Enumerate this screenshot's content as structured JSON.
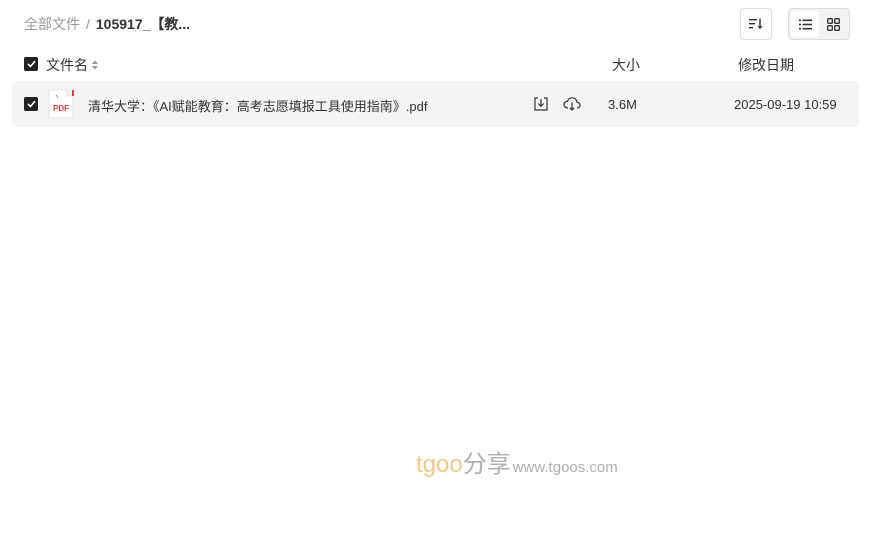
{
  "breadcrumb": {
    "root": "全部文件",
    "separator": "/",
    "current": "105917_【教..."
  },
  "toolbar": {
    "sort_icon": "sort-icon",
    "views": [
      {
        "name": "list-view",
        "icon": "list-icon",
        "active": true
      },
      {
        "name": "grid-view",
        "icon": "grid-icon",
        "active": false
      }
    ]
  },
  "header": {
    "name": "文件名",
    "size": "大小",
    "date": "修改日期"
  },
  "files": [
    {
      "icon": "pdf-file-icon",
      "icon_label": "PDF",
      "name": "清华大学：《AI赋能教育：高考志愿填报工具使用指南》.pdf",
      "size": "3.6M",
      "modified": "2025-09-19 10:59",
      "checked": true
    }
  ],
  "watermark": {
    "brand": "tgoo",
    "cn": "分享",
    "url": "www.tgoos.com"
  },
  "colors": {
    "checkbox": "#222222",
    "row_bg": "#f4f4f4",
    "pdf_red": "#e0403a",
    "watermark_orange": "#f5c98a"
  }
}
